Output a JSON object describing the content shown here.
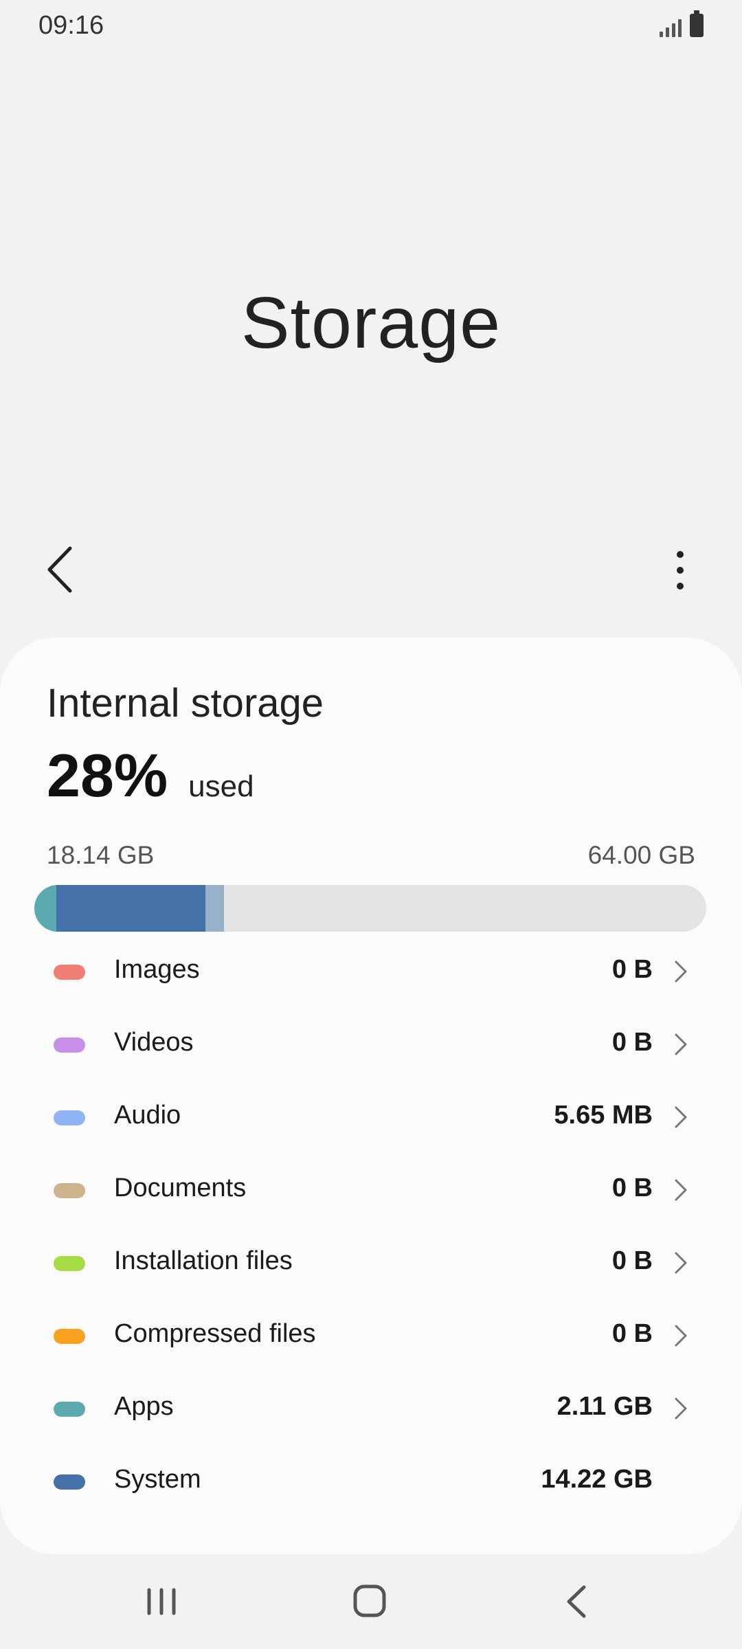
{
  "status_bar": {
    "time": "09:16",
    "icons": [
      "signal-icon",
      "battery-icon"
    ]
  },
  "header": {
    "title": "Storage",
    "back_icon": "back-chevron-icon",
    "more_icon": "more-vertical-icon"
  },
  "storage": {
    "title": "Internal storage",
    "used_percent": "28%",
    "used_label": "used",
    "used_amount": "18.14 GB",
    "total_amount": "64.00 GB",
    "bar_segments": [
      {
        "category": "Apps",
        "fraction_of_total": 0.033,
        "color": "#5aaab0"
      },
      {
        "category": "System",
        "fraction_of_total": 0.222,
        "color": "#4472a8"
      },
      {
        "category": "Other",
        "fraction_of_total": 0.028,
        "color": "#97b1c9"
      }
    ],
    "bar_track_color": "#e3e3e3"
  },
  "categories": [
    {
      "label": "Images",
      "size": "0 B",
      "color": "#f07e72",
      "has_chevron": true
    },
    {
      "label": "Videos",
      "size": "0 B",
      "color": "#c78fe8",
      "has_chevron": true
    },
    {
      "label": "Audio",
      "size": "5.65 MB",
      "color": "#8eb4f5",
      "has_chevron": true
    },
    {
      "label": "Documents",
      "size": "0 B",
      "color": "#ccb38b",
      "has_chevron": true
    },
    {
      "label": "Installation files",
      "size": "0 B",
      "color": "#a6dd44",
      "has_chevron": true
    },
    {
      "label": "Compressed files",
      "size": "0 B",
      "color": "#f9a21f",
      "has_chevron": true
    },
    {
      "label": "Apps",
      "size": "2.11 GB",
      "color": "#5aaab0",
      "has_chevron": true
    },
    {
      "label": "System",
      "size": "14.22 GB",
      "color": "#4472a8",
      "has_chevron": false
    }
  ],
  "nav_bar": {
    "icons": [
      "recents-icon",
      "home-icon",
      "back-icon"
    ]
  }
}
